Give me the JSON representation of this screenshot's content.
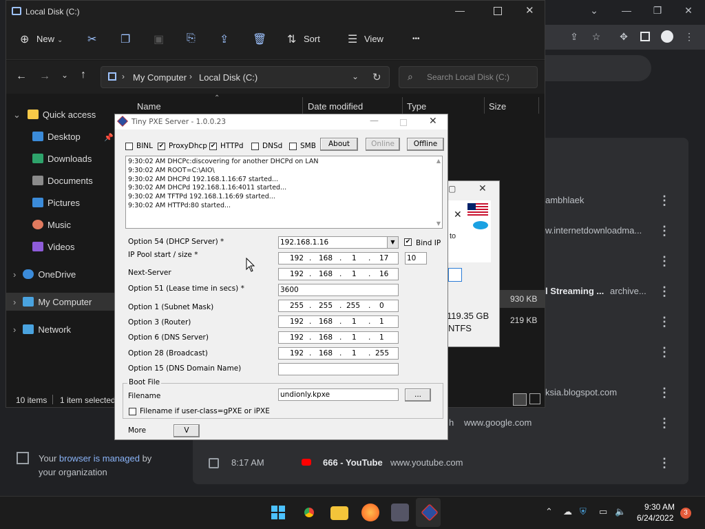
{
  "chrome": {
    "managed_text_1": "Your ",
    "managed_link": "browser is managed",
    "managed_text_2": " by",
    "managed_text_3": "your organization",
    "history": [
      {
        "title": "ambhlaek",
        "url": ""
      },
      {
        "title": "",
        "url": "w.internetdownloadma..."
      },
      {
        "title": "",
        "url": ""
      },
      {
        "title": "l Streaming ...",
        "url": "archive..."
      },
      {
        "title": "",
        "url": ""
      },
      {
        "title": "",
        "url": ""
      },
      {
        "title": "",
        "url": "ksia.blogspot.com"
      },
      {
        "title": "h",
        "url": "www.google.com"
      },
      {
        "time": "8:17 AM",
        "title": "666 - YouTube",
        "url": "www.youtube.com"
      }
    ]
  },
  "explorer": {
    "title": "Local Disk (C:)",
    "toolbar": {
      "new": "New",
      "sort": "Sort",
      "view": "View",
      "more": "•••"
    },
    "breadcrumb": [
      "My Computer",
      "Local Disk (C:)"
    ],
    "search_placeholder": "Search Local Disk (C:)",
    "columns": {
      "name": "Name",
      "date": "Date modified",
      "type": "Type",
      "size": "Size"
    },
    "nav": [
      {
        "label": "Quick access",
        "color": "#f7c948"
      },
      {
        "label": "Desktop",
        "color": "#3b8bd9"
      },
      {
        "label": "Downloads",
        "color": "#2ea36b"
      },
      {
        "label": "Documents",
        "color": "#8b8b8b"
      },
      {
        "label": "Pictures",
        "color": "#3b8bd9"
      },
      {
        "label": "Music",
        "color": "#e07a5f"
      },
      {
        "label": "Videos",
        "color": "#8e5cd9"
      },
      {
        "label": "OneDrive",
        "color": "#3b8bd9"
      },
      {
        "label": "My Computer",
        "color": "#4aa3df"
      },
      {
        "label": "Network",
        "color": "#4aa3df"
      }
    ],
    "sizes": [
      "930 KB",
      "219 KB"
    ],
    "status_items": "10 items",
    "status_selected": "1 item selected"
  },
  "bg_dialog": {
    "text_to": "to",
    "size": "119.35 GB",
    "fs": "NTFS"
  },
  "pxe": {
    "title": "Tiny PXE Server - 1.0.0.23",
    "checks": {
      "binl": "BINL",
      "proxydhcp": "ProxyDhcp",
      "httpd": "HTTPd",
      "dnsd": "DNSd",
      "smb": "SMB"
    },
    "buttons": {
      "about": "About",
      "online": "Online",
      "offline": "Offline",
      "browse": "...",
      "more_v": "V"
    },
    "log": [
      "9:30:02 AM DHCPc:discovering for another DHCPd on LAN",
      "9:30:02 AM ROOT=C:\\AIO\\",
      "9:30:02 AM DHCPd 192.168.1.16:67 started...",
      "9:30:02 AM DHCPd 192.168.1.16:4011 started...",
      "9:30:02 AM TFTPd 192.168.1.16:69 started...",
      "9:30:02 AM HTTPd:80 started..."
    ],
    "labels": {
      "opt54": "Option 54 (DHCP Server) *",
      "pool": "IP Pool start / size *",
      "next": "Next-Server",
      "opt51": "Option 51 (Lease time in secs) *",
      "opt1": "Option 1  (Subnet Mask)",
      "opt3": "Option 3  (Router)",
      "opt6": "Option 6  (DNS Server)",
      "opt28": "Option 28 (Broadcast)",
      "opt15": "Option 15 (DNS Domain Name)",
      "bindip": "Bind IP",
      "bootfile": "Boot File",
      "filename": "Filename",
      "filename_if": "Filename if user-class=gPXE or iPXE",
      "more": "More"
    },
    "values": {
      "opt54": "192.168.1.16",
      "pool": [
        "192",
        "168",
        "1",
        "17"
      ],
      "pool_size": "10",
      "next": [
        "192",
        "168",
        "1",
        "16"
      ],
      "opt51": "3600",
      "opt1": [
        "255",
        "255",
        "255",
        "0"
      ],
      "opt3": [
        "192",
        "168",
        "1",
        "1"
      ],
      "opt6": [
        "192",
        "168",
        "1",
        "1"
      ],
      "opt28": [
        "192",
        "168",
        "1",
        "255"
      ],
      "opt15": "",
      "filename": "undionly.kpxe"
    }
  },
  "taskbar": {
    "time": "9:30 AM",
    "date": "6/24/2022",
    "badge": "3"
  }
}
